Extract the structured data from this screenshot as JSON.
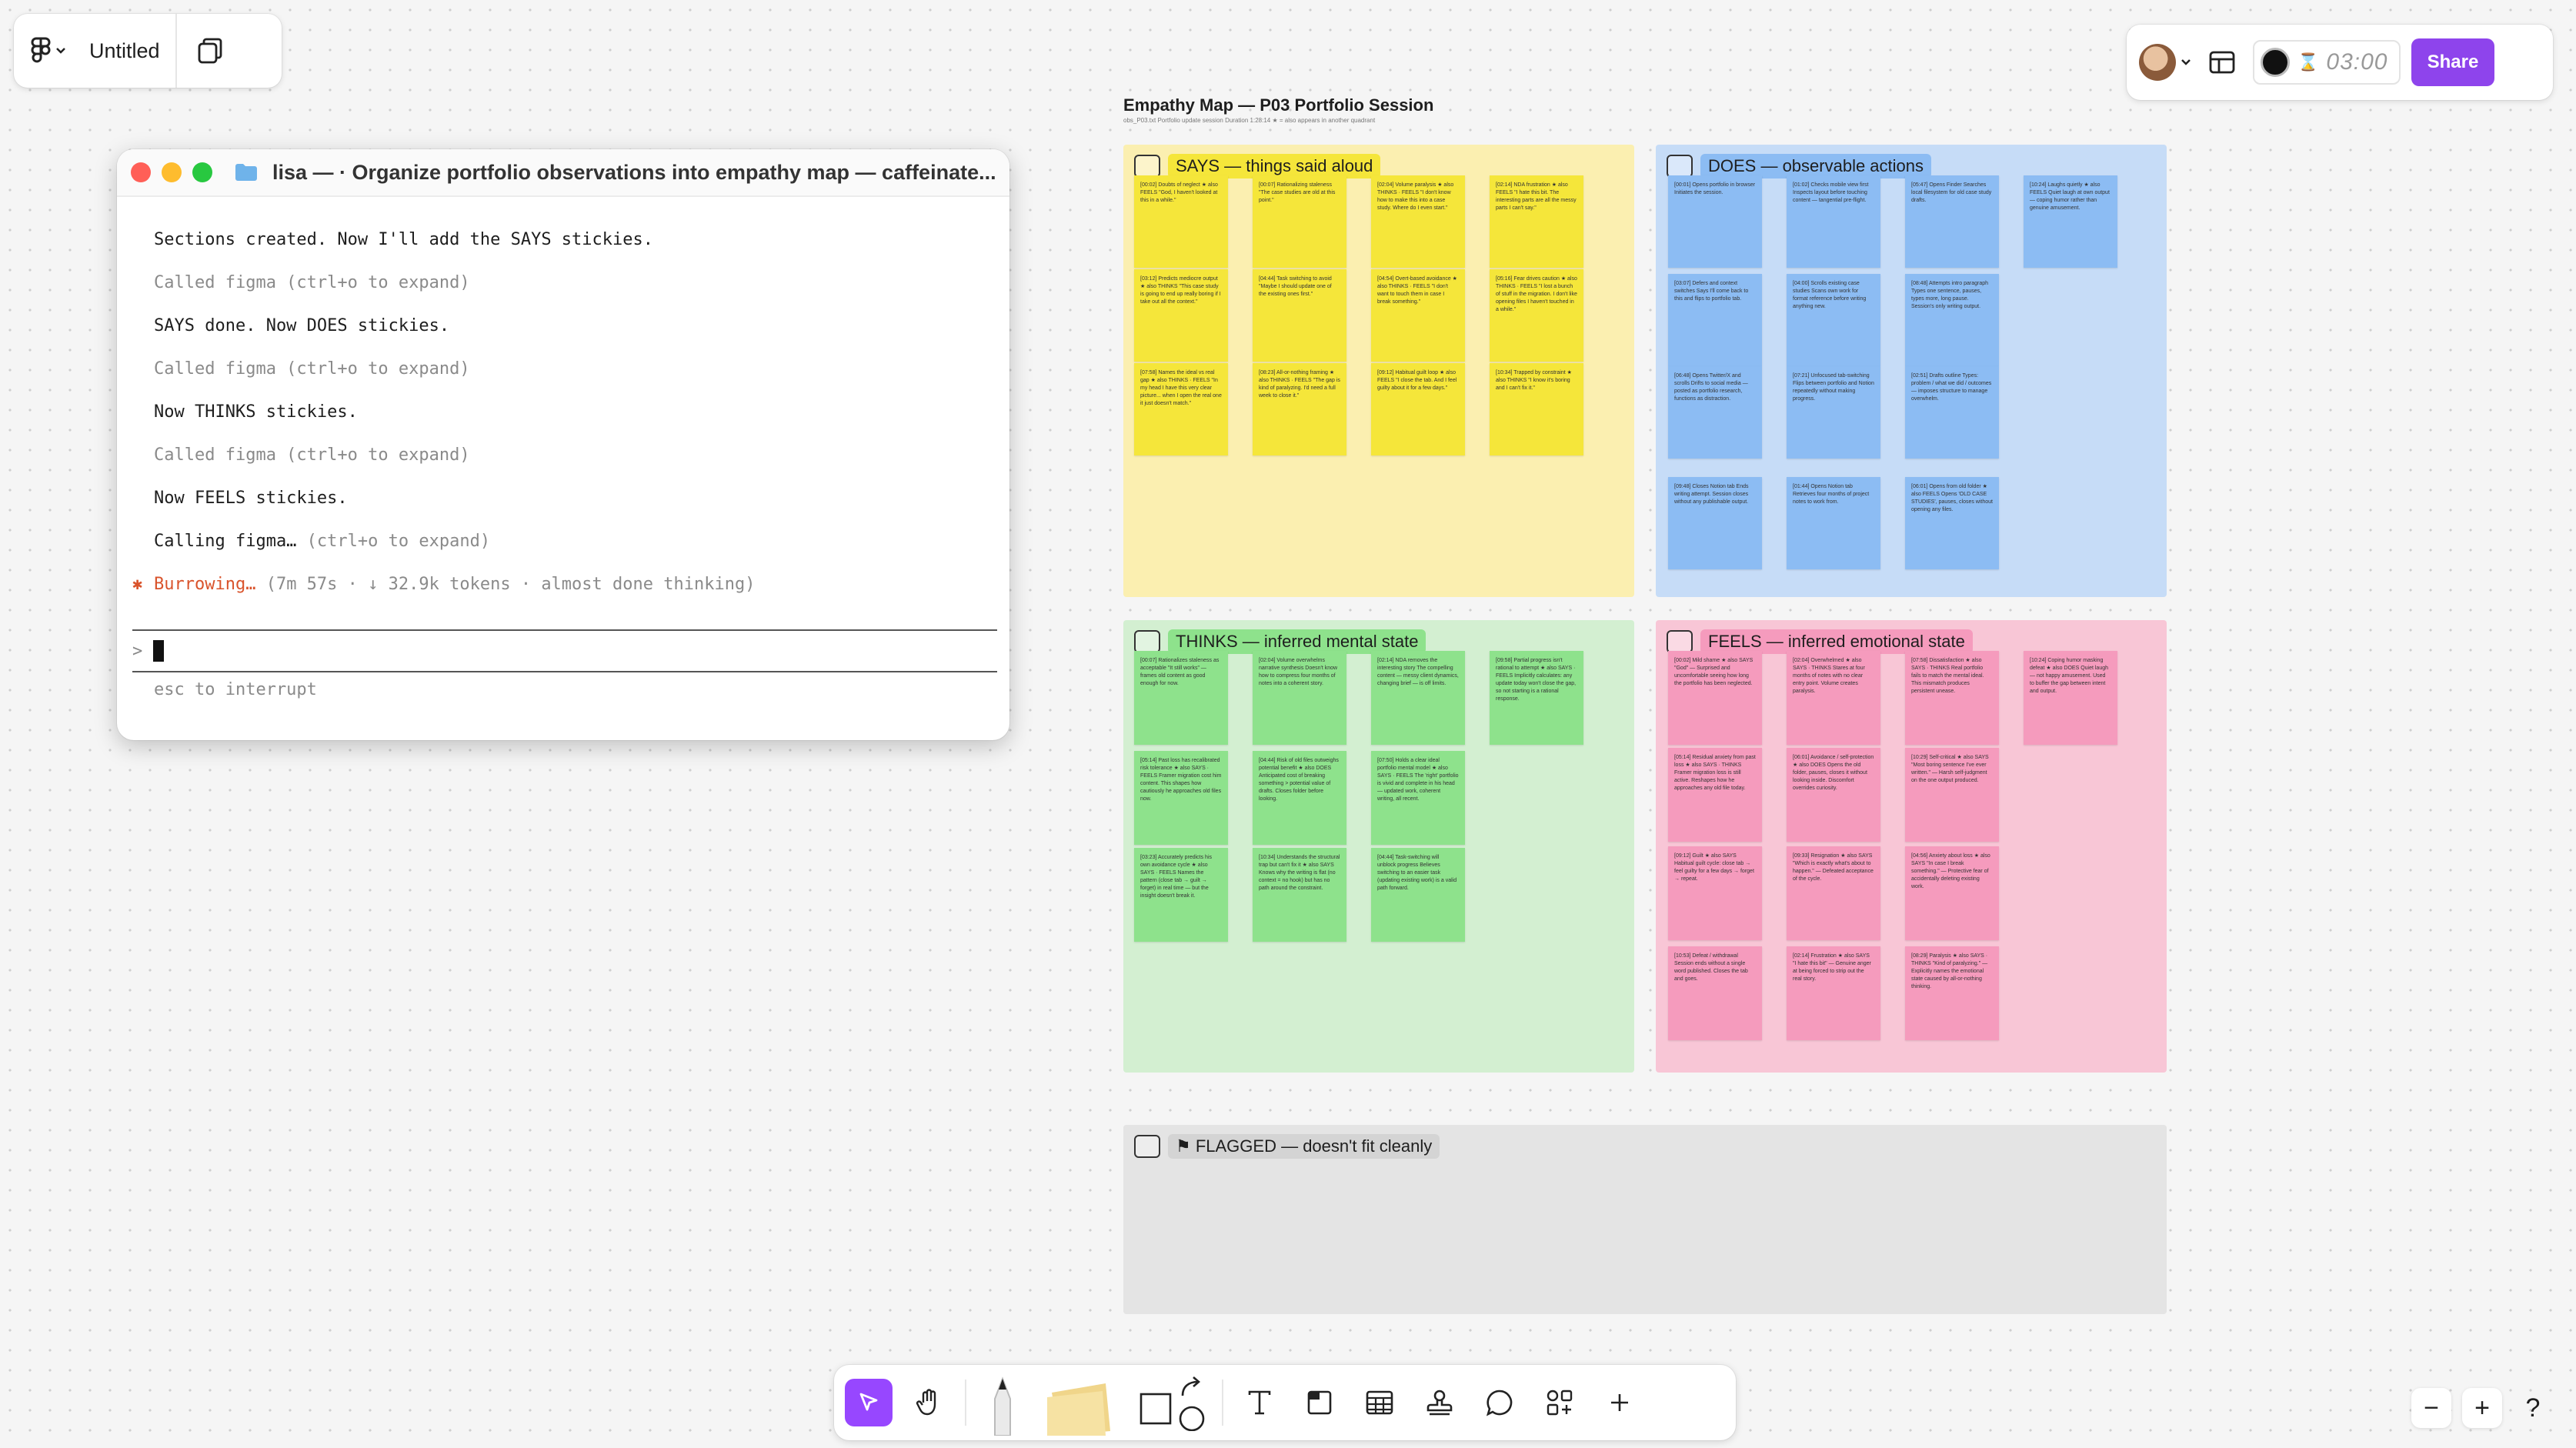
{
  "file": {
    "title": "Untitled"
  },
  "header": {
    "timer": "03:00",
    "share_label": "Share"
  },
  "terminal": {
    "title": "lisa — · Organize portfolio observations into empathy map — caffeinate...",
    "lines": [
      {
        "text": "Sections created. Now I'll add the SAYS stickies.",
        "style": "normal"
      },
      {
        "text": "Called figma (ctrl+o to expand)",
        "style": "gray"
      },
      {
        "text": "SAYS done. Now DOES stickies.",
        "style": "normal"
      },
      {
        "text": "Called figma (ctrl+o to expand)",
        "style": "gray"
      },
      {
        "text": "Now THINKS stickies.",
        "style": "normal"
      },
      {
        "text": "Called figma (ctrl+o to expand)",
        "style": "gray"
      },
      {
        "text": "Now FEELS stickies.",
        "style": "normal"
      },
      {
        "text": "Calling figma…",
        "style": "normal",
        "suffix": " (ctrl+o to expand)"
      }
    ],
    "status_word": "Burrowing…",
    "status_detail": " (7m 57s · ↓ 32.9k tokens · almost done thinking)",
    "prompt_symbol": ">",
    "hint": "esc to interrupt"
  },
  "board": {
    "title": "Empathy Map — P03 Portfolio Session",
    "subtitle": "obs_P03.txt   Portfolio update session   Duration 1:28:14   ★ = also appears in another quadrant",
    "sections": [
      {
        "id": "says",
        "label": "SAYS — things said aloud",
        "bg": "#fbefb0",
        "label_bg": "#f5e63a",
        "stickies": [
          "[00:02] Doubts of neglect ★ also FEELS \"God, I haven't looked at this in a while.\"",
          "[03:12] Predicts mediocre output ★ also THINKS \"This case study is going to end up really boring if I take out all the context.\"",
          "[07:58] Names the ideal vs real gap ★ also THINKS · FEELS \"In my head I have this very clear picture... when I open the real one it just doesn't match.\"",
          "[00:07] Rationalizing staleness \"The case studies are old at this point.\"",
          "[04:44] Task switching to avoid \"Maybe I should update one of the existing ones first.\"",
          "[08:23] All-or-nothing framing ★ also THINKS · FEELS \"The gap is kind of paralyzing. I'd need a full week to close it.\"",
          "[02:04] Volume paralysis ★ also THINKS · FEELS \"I don't know how to make this into a case study. Where do I even start.\"",
          "[04:54] Overt-based avoidance ★ also THINKS · FEELS \"I don't want to touch them in case I break something.\"",
          "[09:12] Habitual guilt loop ★ also FEELS \"I close the tab. And I feel guilty about it for a few days.\"",
          "[02:14] NDA frustration ★ also FEELS \"I hate this bit. The interesting parts are all the messy parts I can't say.\"",
          "[05:16] Fear drives caution ★ also THINKS · FEELS \"I lost a bunch of stuff in the migration. I don't like opening files I haven't touched in a while.\"",
          "[10:34] Trapped by constraint ★ also THINKS \"I know it's boring and I can't fix it.\""
        ]
      },
      {
        "id": "does",
        "label": "DOES — observable actions",
        "bg": "#c6dcf7",
        "label_bg": "#8cbcf3",
        "stickies": [
          "[00:01] Opens portfolio in browser Initiates the session.",
          "[03:07] Defers and context switches Says I'll come back to this and flips to portfolio tab.",
          "[06:48] Opens Twitter/X and scrolls Drifts to social media — posted as portfolio research, functions as distraction.",
          "[09:48] Closes Notion tab Ends writing attempt. Session closes without any publishable output.",
          "[01:02] Checks mobile view first Inspects layout before touching content — tangential pre-flight.",
          "[04:00] Scrolls existing case studies Scans own work for format reference before writing anything new.",
          "[07:21] Unfocused tab-switching Flips between portfolio and Notion repeatedly without making progress.",
          "[01:44] Opens Notion tab Retrieves four months of project notes to work from.",
          "[05:47] Opens Finder Searches local filesystem for old case study drafts.",
          "[08:48] Attempts intro paragraph Types one sentence, pauses, types more, long pause. Session's only writing output.",
          "[02:51] Drafts outline Types: problem / what we did / outcomes — imposes structure to manage overwhelm.",
          "[06:01] Opens from old folder ★ also FEELS Opens 'OLD CASE STUDIES', pauses, closes without opening any files.",
          "[10:24] Laughs quietly ★ also FEELS Quiet laugh at own output — coping humor rather than genuine amusement."
        ]
      },
      {
        "id": "thinks",
        "label": "THINKS — inferred mental state",
        "bg": "#d3efd1",
        "label_bg": "#8ee28c",
        "stickies": [
          "[00:07] Rationalizes staleness as acceptable \"It still works\" — frames old content as good enough for now.",
          "[05:14] Past loss has recalibrated risk tolerance ★ also SAYS · FEELS Framer migration cost him content. This shapes how cautiously he approaches old files now.",
          "[03:23] Accurately predicts his own avoidance cycle ★ also SAYS · FEELS Names the pattern (close tab → guilt → forget) in real time — but the insight doesn't break it.",
          "[02:04] Volume overwhelms narrative synthesis Doesn't know how to compress four months of notes into a coherent story.",
          "[04:44] Risk of old files outweighs potential benefit ★ also DOES Anticipated cost of breaking something > potential value of drafts. Closes folder before looking.",
          "[10:34] Understands the structural trap but can't fix it ★ also SAYS Knows why the writing is flat (no context = no hook) but has no path around the constraint.",
          "[02:14] NDA removes the interesting story The compelling content — messy client dynamics, changing brief — is off limits.",
          "[07:50] Holds a clear ideal portfolio mental model ★ also SAYS · FEELS The 'right' portfolio is vivid and complete in his head — updated work, coherent writing, all recent.",
          "[04:44] Task-switching will unblock progress Believes switching to an easier task (updating existing work) is a valid path forward.",
          "[09:58] Partial progress isn't rational to attempt ★ also SAYS · FEELS Implicitly calculates: any update today won't close the gap, so not starting is a rational response."
        ]
      },
      {
        "id": "feels",
        "label": "FEELS — inferred emotional state",
        "bg": "#f8c6d6",
        "label_bg": "#f59bbd",
        "stickies": [
          "[00:02] Mild shame ★ also SAYS \"God\" — Surprised and uncomfortable seeing how long the portfolio has been neglected.",
          "[05:14] Residual anxiety from past loss ★ also SAYS · THINKS Framer migration loss is still active. Reshapes how he approaches any old file today.",
          "[09:12] Guilt ★ also SAYS Habitual guilt cycle: close tab → feel guilty for a few days → forget → repeat.",
          "[10:53] Defeat / withdrawal Session ends without a single word published. Closes the tab and goes.",
          "[02:04] Overwhelmed ★ also SAYS · THINKS Stares at four months of notes with no clear entry point. Volume creates paralysis.",
          "[06:01] Avoidance / self-protection ★ also DOES Opens the old folder, pauses, closes it without looking inside. Discomfort overrides curiosity.",
          "[09:33] Resignation ★ also SAYS \"Which is exactly what's about to happen.\" — Defeated acceptance of the cycle.",
          "[02:14] Frustration ★ also SAYS \"I hate this bit\" — Genuine anger at being forced to strip out the real story.",
          "[07:58] Dissatisfaction ★ also SAYS · THINKS Real portfolio fails to match the mental ideal. This mismatch produces persistent unease.",
          "[10:29] Self-critical ★ also SAYS \"Most boring sentence I've ever written.\" — Harsh self-judgment on the one output produced.",
          "[04:56] Anxiety about loss ★ also SAYS \"In case I break something.\" — Protective fear of accidentally deleting existing work.",
          "[08:29] Paralysis ★ also SAYS · THINKS \"Kind of paralyzing.\" — Explicitly names the emotional state caused by all-or-nothing thinking.",
          "[10:24] Coping humor masking defeat ★ also DOES Quiet laugh — not happy amusement. Used to buffer the gap between intent and output."
        ]
      },
      {
        "id": "flagged",
        "label": "⚑ FLAGGED — doesn't fit cleanly",
        "bg": "#e4e4e4",
        "label_bg": "#d4d4d4",
        "stickies": []
      }
    ]
  },
  "toolbar": {
    "tools": [
      "move-icon",
      "hand-icon",
      "pen-icon",
      "sticky-icon",
      "shapes-icon",
      "text-icon",
      "section-icon",
      "table-icon",
      "stamp-icon",
      "comment-icon",
      "widgets-icon",
      "plus-icon"
    ]
  },
  "zoom": {
    "out": "−",
    "in": "+",
    "help": "?"
  },
  "colors": {
    "accent": "#9747ff",
    "share": "#8e44ec"
  }
}
